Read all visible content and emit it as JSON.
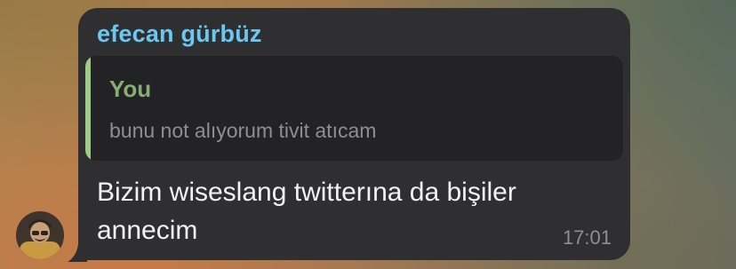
{
  "message": {
    "sender_name": "efecan gürbüz",
    "reply": {
      "author": "You",
      "text": "bunu not alıyorum tivit atıcam"
    },
    "text_line1": "Bizim wiseslang twitterına da bişiler",
    "text_line2": "annecim",
    "time": "17:01"
  },
  "colors": {
    "bubble": "#2f2f31",
    "sender_name": "#6ac7f0",
    "reply_accent": "#9fcb86",
    "reply_author": "#86ad73",
    "muted_text": "#8e8e93"
  },
  "icons": {
    "avatar": "user-photo-avatar"
  }
}
